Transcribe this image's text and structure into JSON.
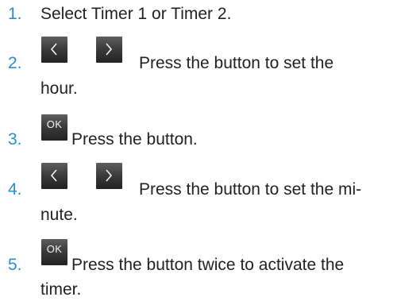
{
  "steps": [
    {
      "number": "1.",
      "text": "Select Timer 1 or Timer 2."
    },
    {
      "number": "2.",
      "line1": "Press the button to set the",
      "line2": "hour.",
      "buttons": [
        "chevron-left-icon",
        "chevron-right-icon"
      ]
    },
    {
      "number": "3.",
      "text": "Press the button.",
      "button_label": "OK"
    },
    {
      "number": "4.",
      "line1": "Press the button to set the mi-",
      "line2": "nute.",
      "buttons": [
        "chevron-left-icon",
        "chevron-right-icon"
      ]
    },
    {
      "number": "5.",
      "line1": "Press the button twice to activate the",
      "line2": "timer.",
      "button_label": "OK"
    }
  ],
  "colors": {
    "number": "#2a8fd1",
    "text": "#222222",
    "button": "#3a3a3a"
  }
}
